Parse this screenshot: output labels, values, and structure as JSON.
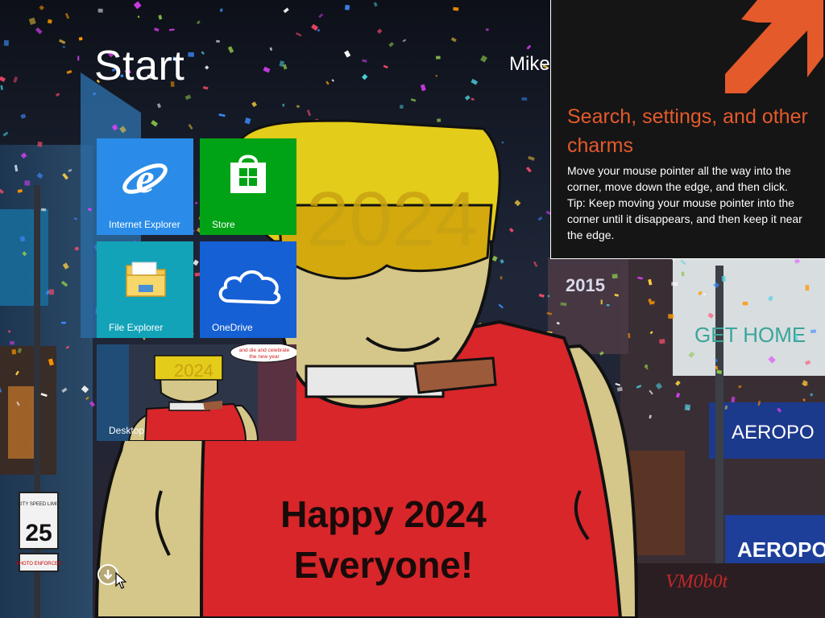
{
  "start": {
    "title": "Start",
    "user_name": "Mike"
  },
  "tiles": [
    {
      "label": "Internet Explorer",
      "icon": "internet-explorer-icon",
      "color": "#2a8ce8"
    },
    {
      "label": "Store",
      "icon": "store-icon",
      "color": "#00a315"
    },
    {
      "label": "File Explorer",
      "icon": "file-explorer-icon",
      "color": "#12a3b8"
    },
    {
      "label": "OneDrive",
      "icon": "onedrive-icon",
      "color": "#1560d4"
    },
    {
      "label": "Desktop",
      "icon": "desktop-wallpaper-thumbnail"
    }
  ],
  "all_apps": {
    "icon": "arrow-down-circle-icon"
  },
  "charms_tip": {
    "heading": "Search, settings, and other charms",
    "body_line1": "Move your mouse pointer all the way into the corner, move down the edge, and then click.",
    "body_line2": "Tip: Keep moving your mouse pointer into the corner until it disappears, and then keep it near the edge.",
    "accent": "#e55a2b",
    "icon": "arrow-up-right-icon"
  },
  "wallpaper": {
    "headline_line1": "Happy 2024",
    "headline_line2": "Everyone!",
    "glasses_text": "2024",
    "speech_bubble_line1": "and die and celebrate",
    "speech_bubble_line2": "the new year",
    "signs": {
      "top_year": "2015",
      "get_home": "GET HOME",
      "aero": "AEROPO",
      "aero2": "AEROPOS",
      "speed_limit_top": "CITY SPEED LIMIT",
      "speed_limit_value": "25",
      "photo_enforced": "PHOTO ENFORCED"
    },
    "signature": "VM0b0t"
  }
}
